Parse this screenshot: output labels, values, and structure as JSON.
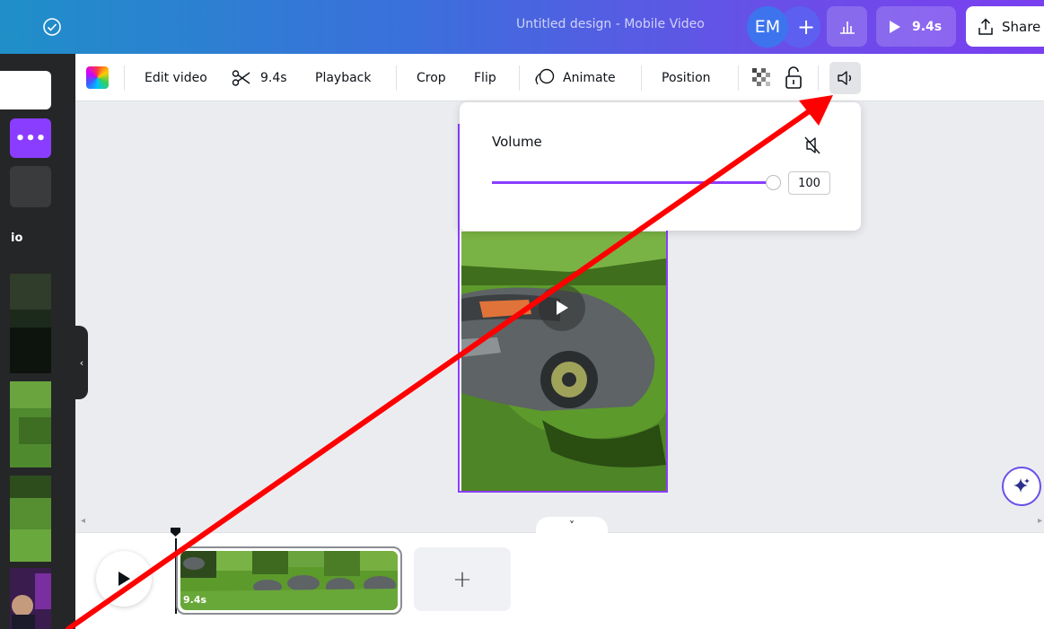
{
  "header": {
    "doc_title": "Untitled design - Mobile Video",
    "avatar_initials": "EM",
    "add_member_label": "+",
    "present_label": "9.4s",
    "share_label": "Share"
  },
  "sidebar": {
    "more_label": "•••",
    "section_label": "io",
    "collapse_label": "‹"
  },
  "toolbar": {
    "edit_video": "Edit video",
    "trim_duration": "9.4s",
    "playback": "Playback",
    "crop": "Crop",
    "flip": "Flip",
    "animate": "Animate",
    "position": "Position"
  },
  "volume_popover": {
    "label": "Volume",
    "value": "100",
    "level_percent": 100
  },
  "timeline": {
    "clip_duration": "9.4s",
    "add_label": "+",
    "toggle_label": "˅"
  },
  "colors": {
    "accent": "#8b3dff",
    "annotation_arrow": "#ff0000"
  }
}
